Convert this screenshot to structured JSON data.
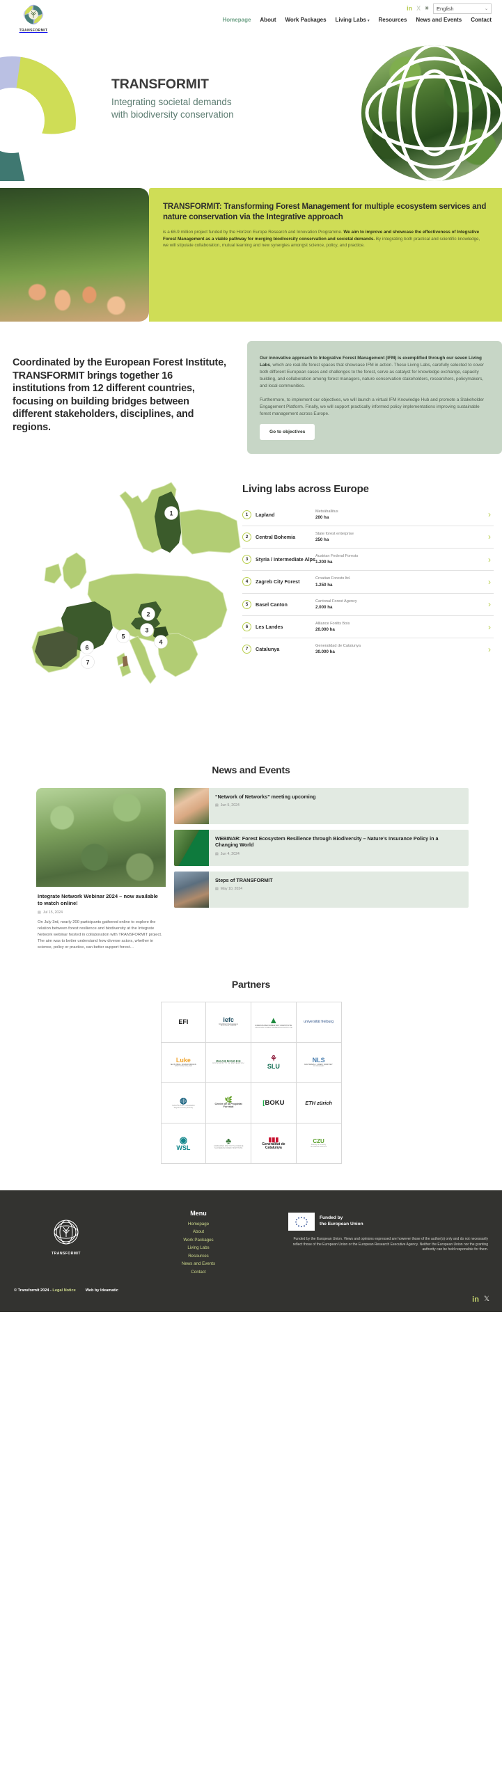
{
  "header": {
    "logo_text": "TRANSFORMIT",
    "social": [
      {
        "name": "linkedin-icon",
        "glyph": "in"
      },
      {
        "name": "x-icon",
        "glyph": "X"
      },
      {
        "name": "star-icon",
        "glyph": "✳"
      }
    ],
    "language": {
      "selected": "English",
      "caret": "⌄"
    },
    "nav": [
      {
        "label": "Homepage",
        "active": true
      },
      {
        "label": "About",
        "active": false
      },
      {
        "label": "Work Packages",
        "active": false
      },
      {
        "label": "Living Labs",
        "active": false,
        "caret": "▾"
      },
      {
        "label": "Resources",
        "active": false
      },
      {
        "label": "News and Events",
        "active": false
      },
      {
        "label": "Contact",
        "active": false
      }
    ]
  },
  "hero": {
    "title": "TRANSFORMIT",
    "subtitle": "Integrating societal demands with biodiversity conservation"
  },
  "band": {
    "heading": "TRANSFORMIT: Transforming Forest Management for multiple ecosystem services and nature conservation via the Integrative approach",
    "p_lead": "is a €6.9 million project funded by the Horizon Europe Research and Innovation Programme. ",
    "p_bold": "We aim to improve and showcase the effectiveness of Integrative Forest Management as a viable pathway for merging biodiversity conservation and societal demands.",
    "p_tail": " By integrating both practical and scientific knowledge, we will stipulate collaboration, mutual learning and new synergies amongst science, policy, and practice."
  },
  "intro": {
    "heading": "Coordinated by the European Forest Institute, TRANSFORMIT brings together 16 institutions from 12 different countries, focusing on building bridges between different stakeholders, disciplines, and regions.",
    "p1_bold": "Our innovative approach to Integrative Forest Management (IFM) is exemplified through our seven Living Labs",
    "p1_rest": ", which are real-life forest spaces that showcase IFM in action. These Living Labs, carefully selected to cover both different European cases and challenges to the forest, serve as catalyst for knowledge exchange, capacity building, and collaboration among forest managers, nature conservation stakeholders, researchers, policymakers, and local communities.",
    "p2": "Furthermore, to implement our objectives, we will launch a virtual IFM Knowledge Hub and promote a Stakeholder Engagement Platform. Finally, we will support practically informed policy implementations improving sustainable forest management across Europe.",
    "button": "Go to objectives"
  },
  "living_labs": {
    "heading": "Living labs across Europe",
    "chevron": "›",
    "items": [
      {
        "num": "1",
        "name": "Lapland",
        "org": "Metsähallitus",
        "area": "200 ha"
      },
      {
        "num": "2",
        "name": "Central Bohemia",
        "org": "State forest enterprise",
        "area": "250 ha"
      },
      {
        "num": "3",
        "name": "Styria / Intermediate Alps",
        "org": "Austrian Federal Forests",
        "area": "1.200 ha"
      },
      {
        "num": "4",
        "name": "Zagreb City Forest",
        "org": "Croatian Forests ltd.",
        "area": "1.250 ha"
      },
      {
        "num": "5",
        "name": "Basel Canton",
        "org": "Cantonal Forest Agency",
        "area": "2.000 ha"
      },
      {
        "num": "6",
        "name": "Les Landes",
        "org": "Alliance Forêts Bois",
        "area": "20.000 ha"
      },
      {
        "num": "7",
        "name": "Catalunya",
        "org": "Generalidad de Catalunya",
        "area": "30.000 ha"
      }
    ],
    "map_markers": [
      "1",
      "2",
      "3",
      "4",
      "5",
      "6",
      "7"
    ]
  },
  "news": {
    "heading": "News and Events",
    "calendar_icon": "▤",
    "featured": {
      "title": "Integrate Network Webinar 2024 – now available to watch online!",
      "date": "Jul 15, 2024",
      "excerpt": "On July 3rd, nearly 200 participants gathered online to explore the relation between forest resilience and biodiversity at the Integrate Network webinar hosted in collaboration with TRANSFORMIT project. The aim was to better understand how diverse actors, whether in science, policy or practice, can better support forest…"
    },
    "cards": [
      {
        "title": "“Network of Networks” meeting upcoming",
        "date": "Jun 5, 2024"
      },
      {
        "title": "WEBINAR: Forest Ecosystem Resilience through Biodiversity – Nature’s Insurance Policy in a Changing World",
        "date": "Jun 4, 2024"
      },
      {
        "title": "Steps of TRANSFORMIT",
        "date": "May 10, 2024"
      }
    ]
  },
  "partners": {
    "heading": "Partners",
    "logos": [
      {
        "name": "EFI",
        "sub": "",
        "tiny": ""
      },
      {
        "name": "iefc",
        "sub": "Institut Européen",
        "tiny": "de la Forêt Cultivée"
      },
      {
        "name": "",
        "sub": "CROATIAN FORESTRY INSTITUTE",
        "tiny": "CROATIAN FOREST RESEARCH INSTITUTE"
      },
      {
        "name": "universität freiburg",
        "sub": "",
        "tiny": ""
      },
      {
        "name": "Luke",
        "sub": "NATURAL RESOURCES",
        "tiny": "INSTITUTE FINLAND"
      },
      {
        "name": "WAGENINGEN",
        "sub": "UNIVERSITY & RESEARCH",
        "tiny": ""
      },
      {
        "name": "SLU",
        "sub": "",
        "tiny": ""
      },
      {
        "name": "NLS",
        "sub": "NATIONAL LAND SURVEY",
        "tiny": "OF FINLAND"
      },
      {
        "name": "",
        "sub": "SVEUČILIŠTE U ZAGREBU",
        "tiny": "Zagreb Forestry Faculty"
      },
      {
        "name": "",
        "sub": "Centre de la Propietat",
        "tiny": "Forestal"
      },
      {
        "name": "BOKU",
        "sub": "",
        "tiny": ""
      },
      {
        "name": "ETH zürich",
        "sub": "",
        "tiny": ""
      },
      {
        "name": "WSL",
        "sub": "",
        "tiny": ""
      },
      {
        "name": "",
        "sub": "GOZDARSKI INŠTITUT SLOVENIJE",
        "tiny": "SLOVENIAN FOREST INSTITUTE"
      },
      {
        "name": "Generalitat de Catalunya",
        "sub": "",
        "tiny": ""
      },
      {
        "name": "CZU",
        "sub": "Faculty of Forestry",
        "tiny": "and Wood Sciences"
      }
    ]
  },
  "footer": {
    "logo_text": "TRANSFORMIT",
    "menu_title": "Menu",
    "menu": [
      {
        "label": "Homepage"
      },
      {
        "label": "About"
      },
      {
        "label": "Work Packages"
      },
      {
        "label": "Living Labs"
      },
      {
        "label": "Resources"
      },
      {
        "label": "News and Events"
      },
      {
        "label": "Contact"
      }
    ],
    "eu_label": "Funded by\nthe European Union",
    "eu_label_l1": "Funded by",
    "eu_label_l2": "the European Union",
    "eu_disclaimer": "Funded by the European Union. Views and opinions expressed are however those of the author(s) only and do not necessarily reflect those of the European Union or the European Research Executive Agency. Neither the European Union nor the granting authority can be held responsible for them.",
    "copyright": "© Transformit 2024 - ",
    "legal_notice": "Legal Notice",
    "web_by": "Web by Ideamatic",
    "social": [
      {
        "name": "linkedin-icon",
        "glyph": "in"
      },
      {
        "name": "x-icon",
        "glyph": "𝕏"
      }
    ]
  },
  "colors": {
    "lime": "#cfdd56",
    "sage": "#c7d6c6",
    "teal_text": "#5d7d72",
    "footer_bg": "#333330",
    "footer_link": "#cdd98c"
  }
}
